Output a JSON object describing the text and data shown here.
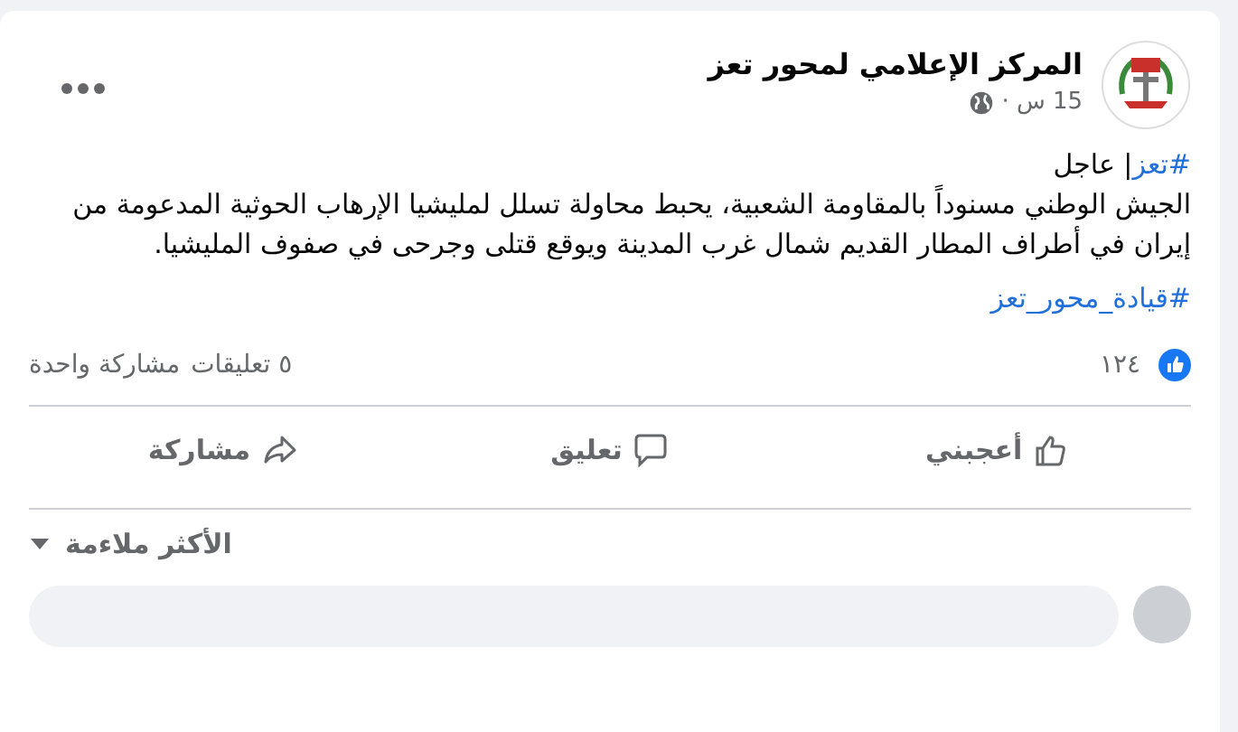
{
  "post": {
    "author": "المركز الإعلامي لمحور تعز",
    "time": "15 س",
    "separator": "·",
    "headline": {
      "tag": "#تعز",
      "rest": "| عاجل"
    },
    "body": "الجيش الوطني مسنوداً بالمقاومة الشعبية، يحبط محاولة تسلل لمليشيا الإرهاب الحوثية المدعومة من إيران في أطراف المطار القديم شمال غرب المدينة ويوقع قتلى وجرحى في صفوف المليشيا.",
    "footer_tag": "#قيادة_محور_تعز"
  },
  "stats": {
    "likes": "١٢٤",
    "comments": "٥ تعليقات",
    "shares": "مشاركة واحدة"
  },
  "actions": [
    {
      "kind": "like",
      "label": "أعجبني"
    },
    {
      "kind": "comment",
      "label": "تعليق"
    },
    {
      "kind": "share",
      "label": "مشاركة"
    }
  ],
  "sort": {
    "label": "الأكثر ملاءمة"
  }
}
